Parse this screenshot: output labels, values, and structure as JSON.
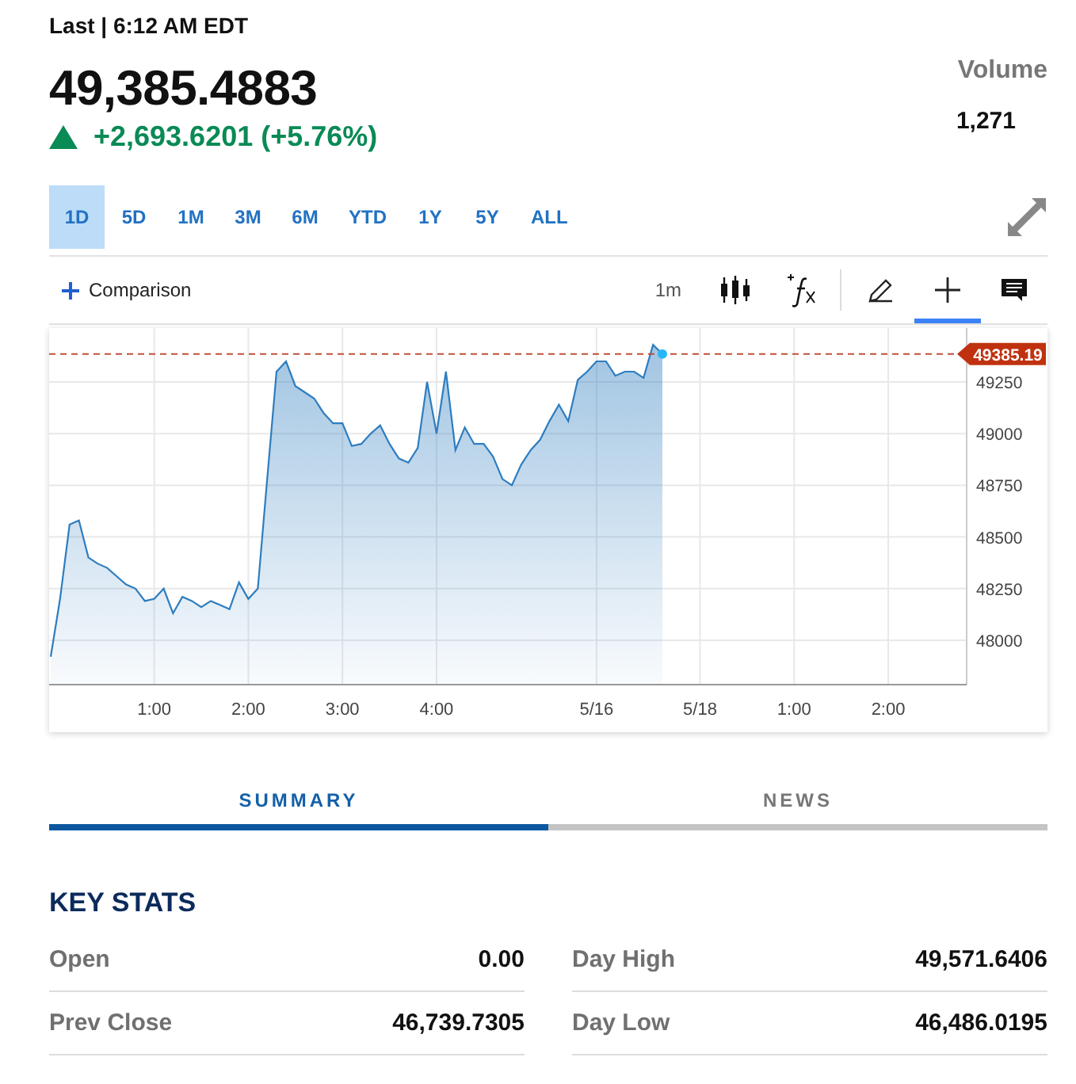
{
  "header": {
    "last_label": "Last | 6:12 AM EDT",
    "price": "49,385.4883",
    "change": "+2,693.6201 (+5.76%)",
    "up": true,
    "volume_label": "Volume",
    "volume": "1,271"
  },
  "ranges": [
    {
      "label": "1D",
      "selected": true
    },
    {
      "label": "5D",
      "selected": false
    },
    {
      "label": "1M",
      "selected": false
    },
    {
      "label": "3M",
      "selected": false
    },
    {
      "label": "6M",
      "selected": false
    },
    {
      "label": "YTD",
      "selected": false
    },
    {
      "label": "1Y",
      "selected": false
    },
    {
      "label": "5Y",
      "selected": false
    },
    {
      "label": "ALL",
      "selected": false
    }
  ],
  "toolbar": {
    "comparison": "Comparison",
    "interval": "1m",
    "tools": [
      {
        "kind": "pencil",
        "selected": false
      },
      {
        "kind": "crosshair",
        "selected": true
      },
      {
        "kind": "comment",
        "selected": false
      }
    ]
  },
  "chart": {
    "chart_data": {
      "type": "area",
      "grid": true,
      "ref_lines": [
        {
          "axis": "y",
          "value": 49385.19,
          "label": "49385.19",
          "color": "#c0503a"
        }
      ],
      "categories": [
        null,
        null,
        null,
        null,
        null,
        null,
        null,
        null,
        null,
        null,
        null,
        "1:00",
        null,
        null,
        null,
        null,
        null,
        null,
        null,
        null,
        null,
        "2:00",
        null,
        null,
        null,
        null,
        null,
        null,
        null,
        null,
        null,
        "3:00",
        null,
        null,
        null,
        null,
        null,
        null,
        null,
        null,
        null,
        "4:00",
        null,
        null,
        null,
        null,
        null,
        null,
        null,
        null,
        null,
        null,
        null,
        null,
        null,
        null,
        null,
        null,
        "5/16",
        null,
        null,
        null,
        null,
        null,
        null,
        null,
        null,
        null,
        null,
        "5/18",
        null,
        null,
        null,
        null,
        null,
        null,
        null,
        null,
        null,
        "1:00",
        null,
        null,
        null,
        null,
        null,
        null,
        null,
        null,
        null,
        "2:00",
        null,
        null,
        null,
        null,
        null,
        null,
        null,
        null
      ],
      "series": [
        {
          "color": "#2e7dbf",
          "values": [
            47920,
            48200,
            48560,
            48580,
            48400,
            48370,
            48350,
            48310,
            48270,
            48250,
            48190,
            48200,
            48250,
            48130,
            48210,
            48190,
            48160,
            48190,
            48170,
            48150,
            48280,
            48200,
            48250,
            48780,
            49300,
            49350,
            49230,
            49200,
            49170,
            49100,
            49050,
            49050,
            48940,
            48950,
            49000,
            49040,
            48950,
            48880,
            48860,
            48930,
            49250,
            49000,
            49300,
            48920,
            49030,
            48950,
            48950,
            48890,
            48780,
            48750,
            48850,
            48920,
            48970,
            49060,
            49140,
            49060,
            49260,
            49300,
            49350,
            49350,
            49280,
            49300,
            49300,
            49270,
            49430,
            49385,
            null,
            null,
            null,
            null,
            null,
            null,
            null,
            null,
            null,
            null,
            null,
            null,
            null,
            null,
            null,
            null,
            null,
            null,
            null,
            null,
            null,
            null,
            null,
            null,
            null,
            null,
            null,
            null,
            null,
            null,
            null,
            null
          ]
        }
      ],
      "ylim": [
        47785,
        49511
      ],
      "yticks": [
        48000,
        48250,
        48500,
        48750,
        49000,
        49250
      ]
    }
  },
  "tabs": [
    {
      "label": "SUMMARY",
      "selected": true
    },
    {
      "label": "NEWS",
      "selected": false
    }
  ],
  "key_stats": {
    "title": "KEY STATS",
    "rows": [
      [
        {
          "label": "Open",
          "value": "0.00"
        },
        {
          "label": "Day High",
          "value": "49,571.6406"
        }
      ],
      [
        {
          "label": "Prev Close",
          "value": "46,739.7305"
        },
        {
          "label": "Day Low",
          "value": "46,486.0195"
        }
      ]
    ]
  }
}
